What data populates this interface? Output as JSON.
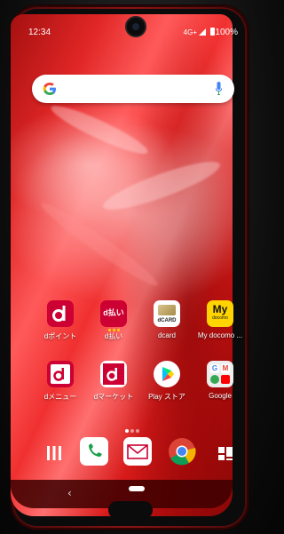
{
  "status_bar": {
    "time": "12:34",
    "network": "4G+",
    "battery": "100%"
  },
  "search": {},
  "apps_row1": [
    {
      "label": "dポイント",
      "icon": "dpoint-icon"
    },
    {
      "label": "d払い",
      "icon": "dbarai-icon",
      "icon_text": "d払い"
    },
    {
      "label": "dcard",
      "icon": "dcard-icon",
      "icon_text": "dCARD"
    },
    {
      "label": "My docomo ...",
      "icon": "mydocomo-icon",
      "icon_text": "My",
      "icon_sub": "docomo"
    }
  ],
  "apps_row2": [
    {
      "label": "dメニュー",
      "icon": "dmenu-icon"
    },
    {
      "label": "dマーケット",
      "icon": "dmarket-icon"
    },
    {
      "label": "Play ストア",
      "icon": "play-store-icon"
    },
    {
      "label": "Google",
      "icon": "google-folder-icon"
    }
  ],
  "dock": [
    "app-drawer-icon",
    "phone-icon",
    "mail-icon",
    "chrome-icon",
    "widgets-icon"
  ],
  "nav": {
    "back": "‹"
  },
  "colors": {
    "docomo_red": "#cc0033",
    "wallpaper": "#e12626",
    "mydocomo_yellow": "#ffd400"
  }
}
